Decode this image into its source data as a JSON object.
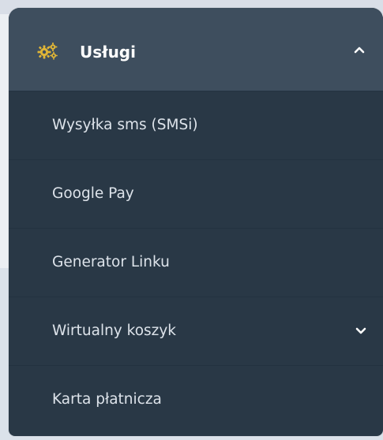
{
  "services_menu": {
    "header": {
      "label": "Usługi",
      "icon": "gears-icon",
      "expanded": true,
      "icon_color": "#e0b536"
    },
    "items": [
      {
        "label": "Wysyłka sms (SMSi)",
        "has_submenu": false
      },
      {
        "label": "Google Pay",
        "has_submenu": false
      },
      {
        "label": "Generator Linku",
        "has_submenu": false
      },
      {
        "label": "Wirtualny koszyk",
        "has_submenu": true
      },
      {
        "label": "Karta płatnicza",
        "has_submenu": false
      }
    ]
  },
  "colors": {
    "menu_background": "#293846",
    "header_background": "#3e4e5e",
    "text": "#dde3ea"
  }
}
